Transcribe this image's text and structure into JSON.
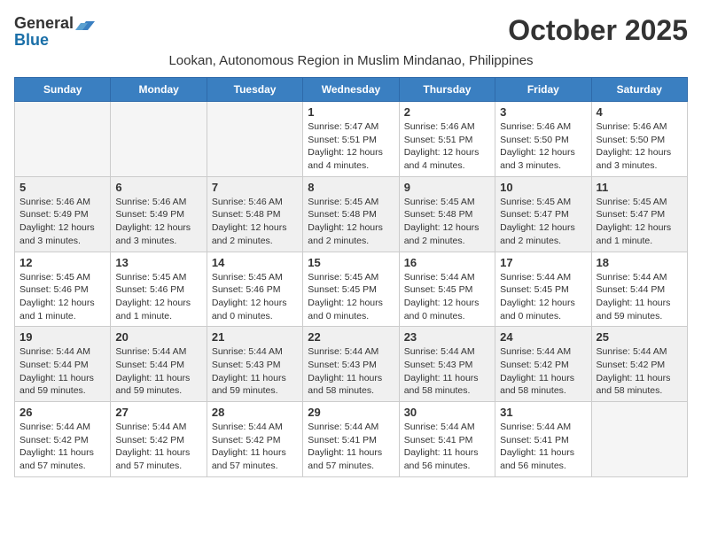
{
  "header": {
    "logo_general": "General",
    "logo_blue": "Blue",
    "month": "October 2025",
    "location": "Lookan, Autonomous Region in Muslim Mindanao, Philippines"
  },
  "days_of_week": [
    "Sunday",
    "Monday",
    "Tuesday",
    "Wednesday",
    "Thursday",
    "Friday",
    "Saturday"
  ],
  "weeks": [
    [
      {
        "day": "",
        "info": ""
      },
      {
        "day": "",
        "info": ""
      },
      {
        "day": "",
        "info": ""
      },
      {
        "day": "1",
        "info": "Sunrise: 5:47 AM\nSunset: 5:51 PM\nDaylight: 12 hours\nand 4 minutes."
      },
      {
        "day": "2",
        "info": "Sunrise: 5:46 AM\nSunset: 5:51 PM\nDaylight: 12 hours\nand 4 minutes."
      },
      {
        "day": "3",
        "info": "Sunrise: 5:46 AM\nSunset: 5:50 PM\nDaylight: 12 hours\nand 3 minutes."
      },
      {
        "day": "4",
        "info": "Sunrise: 5:46 AM\nSunset: 5:50 PM\nDaylight: 12 hours\nand 3 minutes."
      }
    ],
    [
      {
        "day": "5",
        "info": "Sunrise: 5:46 AM\nSunset: 5:49 PM\nDaylight: 12 hours\nand 3 minutes."
      },
      {
        "day": "6",
        "info": "Sunrise: 5:46 AM\nSunset: 5:49 PM\nDaylight: 12 hours\nand 3 minutes."
      },
      {
        "day": "7",
        "info": "Sunrise: 5:46 AM\nSunset: 5:48 PM\nDaylight: 12 hours\nand 2 minutes."
      },
      {
        "day": "8",
        "info": "Sunrise: 5:45 AM\nSunset: 5:48 PM\nDaylight: 12 hours\nand 2 minutes."
      },
      {
        "day": "9",
        "info": "Sunrise: 5:45 AM\nSunset: 5:48 PM\nDaylight: 12 hours\nand 2 minutes."
      },
      {
        "day": "10",
        "info": "Sunrise: 5:45 AM\nSunset: 5:47 PM\nDaylight: 12 hours\nand 2 minutes."
      },
      {
        "day": "11",
        "info": "Sunrise: 5:45 AM\nSunset: 5:47 PM\nDaylight: 12 hours\nand 1 minute."
      }
    ],
    [
      {
        "day": "12",
        "info": "Sunrise: 5:45 AM\nSunset: 5:46 PM\nDaylight: 12 hours\nand 1 minute."
      },
      {
        "day": "13",
        "info": "Sunrise: 5:45 AM\nSunset: 5:46 PM\nDaylight: 12 hours\nand 1 minute."
      },
      {
        "day": "14",
        "info": "Sunrise: 5:45 AM\nSunset: 5:46 PM\nDaylight: 12 hours\nand 0 minutes."
      },
      {
        "day": "15",
        "info": "Sunrise: 5:45 AM\nSunset: 5:45 PM\nDaylight: 12 hours\nand 0 minutes."
      },
      {
        "day": "16",
        "info": "Sunrise: 5:44 AM\nSunset: 5:45 PM\nDaylight: 12 hours\nand 0 minutes."
      },
      {
        "day": "17",
        "info": "Sunrise: 5:44 AM\nSunset: 5:45 PM\nDaylight: 12 hours\nand 0 minutes."
      },
      {
        "day": "18",
        "info": "Sunrise: 5:44 AM\nSunset: 5:44 PM\nDaylight: 11 hours\nand 59 minutes."
      }
    ],
    [
      {
        "day": "19",
        "info": "Sunrise: 5:44 AM\nSunset: 5:44 PM\nDaylight: 11 hours\nand 59 minutes."
      },
      {
        "day": "20",
        "info": "Sunrise: 5:44 AM\nSunset: 5:44 PM\nDaylight: 11 hours\nand 59 minutes."
      },
      {
        "day": "21",
        "info": "Sunrise: 5:44 AM\nSunset: 5:43 PM\nDaylight: 11 hours\nand 59 minutes."
      },
      {
        "day": "22",
        "info": "Sunrise: 5:44 AM\nSunset: 5:43 PM\nDaylight: 11 hours\nand 58 minutes."
      },
      {
        "day": "23",
        "info": "Sunrise: 5:44 AM\nSunset: 5:43 PM\nDaylight: 11 hours\nand 58 minutes."
      },
      {
        "day": "24",
        "info": "Sunrise: 5:44 AM\nSunset: 5:42 PM\nDaylight: 11 hours\nand 58 minutes."
      },
      {
        "day": "25",
        "info": "Sunrise: 5:44 AM\nSunset: 5:42 PM\nDaylight: 11 hours\nand 58 minutes."
      }
    ],
    [
      {
        "day": "26",
        "info": "Sunrise: 5:44 AM\nSunset: 5:42 PM\nDaylight: 11 hours\nand 57 minutes."
      },
      {
        "day": "27",
        "info": "Sunrise: 5:44 AM\nSunset: 5:42 PM\nDaylight: 11 hours\nand 57 minutes."
      },
      {
        "day": "28",
        "info": "Sunrise: 5:44 AM\nSunset: 5:42 PM\nDaylight: 11 hours\nand 57 minutes."
      },
      {
        "day": "29",
        "info": "Sunrise: 5:44 AM\nSunset: 5:41 PM\nDaylight: 11 hours\nand 57 minutes."
      },
      {
        "day": "30",
        "info": "Sunrise: 5:44 AM\nSunset: 5:41 PM\nDaylight: 11 hours\nand 56 minutes."
      },
      {
        "day": "31",
        "info": "Sunrise: 5:44 AM\nSunset: 5:41 PM\nDaylight: 11 hours\nand 56 minutes."
      },
      {
        "day": "",
        "info": ""
      }
    ]
  ]
}
